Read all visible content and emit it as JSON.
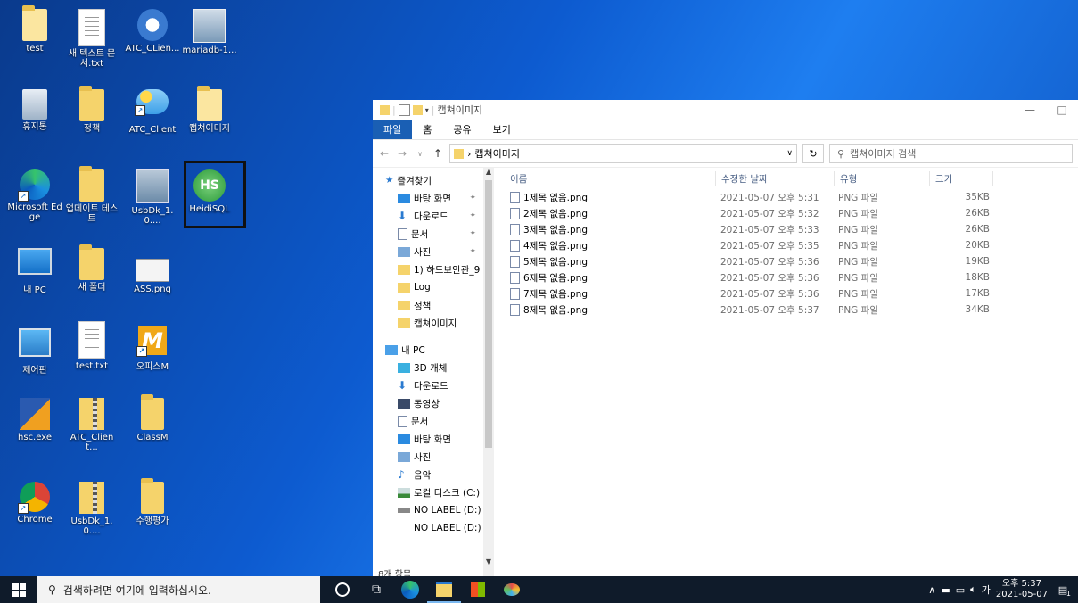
{
  "desktop": {
    "icons": [
      {
        "label": "test"
      },
      {
        "label": "새 텍스트 문서.txt"
      },
      {
        "label": "ATC_CLien..."
      },
      {
        "label": "mariadb-1..."
      },
      {
        "label": "휴지통"
      },
      {
        "label": "정책"
      },
      {
        "label": "ATC_Client"
      },
      {
        "label": "캡쳐이미지"
      },
      {
        "label": "Microsoft Edge"
      },
      {
        "label": "업데이트 테스트"
      },
      {
        "label": "UsbDk_1.0...."
      },
      {
        "label": "HeidiSQL"
      },
      {
        "label": "내 PC"
      },
      {
        "label": "새 폴더"
      },
      {
        "label": "ASS.png"
      },
      {
        "label": "제어판"
      },
      {
        "label": "test.txt"
      },
      {
        "label": "오피스M"
      },
      {
        "label": "hsc.exe"
      },
      {
        "label": "ATC_Client..."
      },
      {
        "label": "ClassM"
      },
      {
        "label": "Chrome"
      },
      {
        "label": "UsbDk_1.0...."
      },
      {
        "label": "수행평가"
      }
    ],
    "heidisql_badge": "HS"
  },
  "explorer": {
    "title": "캡쳐이미지",
    "window_min": "—",
    "window_max": "□",
    "ribbon_tabs": [
      "파일",
      "홈",
      "공유",
      "보기"
    ],
    "address_path": "캡쳐이미지",
    "address_sep": "›",
    "search_placeholder": "캡쳐이미지 검색",
    "nav": {
      "quick_access": "즐겨찾기",
      "quick_items": [
        "바탕 화면",
        "다운로드",
        "문서",
        "사진",
        "1) 하드보안관_9",
        "Log",
        "정책",
        "캡쳐이미지"
      ],
      "this_pc": "내 PC",
      "pc_items": [
        "3D 개체",
        "다운로드",
        "동영상",
        "문서",
        "바탕 화면",
        "사진",
        "음악",
        "로컬 디스크 (C:)",
        "NO LABEL (D:)",
        "NO LABEL (D:)"
      ]
    },
    "columns": {
      "name": "이름",
      "date": "수정한 날짜",
      "type": "유형",
      "size": "크기"
    },
    "files": [
      {
        "name": "1제목 없음.png",
        "date": "2021-05-07 오후 5:31",
        "type": "PNG 파일",
        "size": "35KB"
      },
      {
        "name": "2제목 없음.png",
        "date": "2021-05-07 오후 5:32",
        "type": "PNG 파일",
        "size": "26KB"
      },
      {
        "name": "3제목 없음.png",
        "date": "2021-05-07 오후 5:33",
        "type": "PNG 파일",
        "size": "26KB"
      },
      {
        "name": "4제목 없음.png",
        "date": "2021-05-07 오후 5:35",
        "type": "PNG 파일",
        "size": "20KB"
      },
      {
        "name": "5제목 없음.png",
        "date": "2021-05-07 오후 5:36",
        "type": "PNG 파일",
        "size": "19KB"
      },
      {
        "name": "6제목 없음.png",
        "date": "2021-05-07 오후 5:36",
        "type": "PNG 파일",
        "size": "18KB"
      },
      {
        "name": "7제목 없음.png",
        "date": "2021-05-07 오후 5:36",
        "type": "PNG 파일",
        "size": "17KB"
      },
      {
        "name": "8제목 없음.png",
        "date": "2021-05-07 오후 5:37",
        "type": "PNG 파일",
        "size": "34KB"
      }
    ],
    "status": "8개 항목"
  },
  "taskbar": {
    "search_placeholder": "검색하려면 여기에 입력하십시오.",
    "ime": "가",
    "time": "오후 5:37",
    "date": "2021-05-07",
    "notification_count": "1"
  },
  "colors": {
    "accent": "#1a5fb4",
    "folder": "#f5d36b",
    "taskbar": "#0f1b2a"
  }
}
